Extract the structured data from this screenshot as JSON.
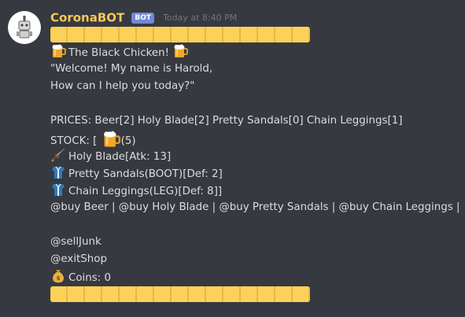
{
  "author": {
    "username": "CoronaBOT",
    "bot_tag": "BOT",
    "timestamp": "Today at 8:40 PM"
  },
  "colors": {
    "background": "#36393f",
    "username": "#f7c95a",
    "bot_tag": "#7289da",
    "banner": "#fcd15a",
    "text": "#dcddde"
  },
  "message": {
    "shop_title": "The Black Chicken!",
    "greeting_line1": "\"Welcome! My name is Harold,",
    "greeting_line2": "How can I help you today?\"",
    "prices": "PRICES: Beer[2] Holy Blade[2] Pretty Sandals[0] Chain Leggings[1]",
    "stock_prefix": "STOCK: [",
    "stock_beer_count": "(5)",
    "item_holy_blade": "Holy Blade[Atk: 13]",
    "item_pretty_sandals": "Pretty Sandals(BOOT)[Def: 2]",
    "item_chain_leggings": "Chain Leggings(LEG)[Def: 8]]",
    "buy_commands": "@buy Beer | @buy Holy Blade | @buy Pretty Sandals | @buy Chain Leggings |",
    "sell_command": "@sellJunk",
    "exit_command": "@exitShop",
    "coins": "Coins: 0"
  },
  "icons": {
    "beer": "beer-mug-icon",
    "dagger": "dagger-icon",
    "armor": "armor-icon",
    "money_bag": "money-bag-icon"
  }
}
